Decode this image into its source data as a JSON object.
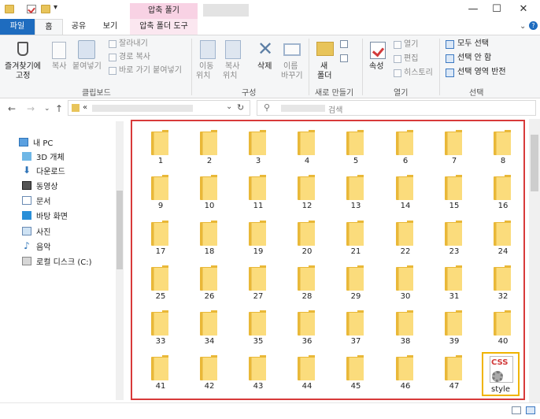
{
  "titlebar": {
    "context_tab_label": "압축 풀기",
    "minimize": "—",
    "maximize": "☐",
    "close": "✕"
  },
  "ribbon_tabs": {
    "file": "파일",
    "home": "홈",
    "share": "공유",
    "view": "보기",
    "context": "압축 폴더 도구"
  },
  "ribbon": {
    "clipboard": {
      "pin_line1": "즐겨찾기에",
      "pin_line2": "고정",
      "copy": "복사",
      "paste": "붙여넣기",
      "cut": "잘라내기",
      "copy_path": "경로 복사",
      "paste_shortcut": "바로 가기 붙여넣기",
      "group": "클립보드"
    },
    "organize": {
      "move_line1": "이동",
      "move_line2": "위치",
      "copyto_line1": "복사",
      "copyto_line2": "위치",
      "delete": "삭제",
      "rename_line1": "이름",
      "rename_line2": "바꾸기",
      "group": "구성"
    },
    "new": {
      "folder_line1": "새",
      "folder_line2": "폴더",
      "group": "새로 만들기"
    },
    "open": {
      "properties": "속성",
      "open": "열기",
      "edit": "편집",
      "history": "히스토리",
      "group": "열기"
    },
    "select": {
      "select_all": "모두 선택",
      "select_none": "선택 안 함",
      "invert": "선택 영역 반전",
      "group": "선택"
    }
  },
  "address": {
    "chevron": "«",
    "search_label": "검색"
  },
  "nav_pane": {
    "items": [
      {
        "label": "내 PC",
        "icon": "computer-icon"
      },
      {
        "label": "3D 개체",
        "icon": "3d-objects-icon"
      },
      {
        "label": "다운로드",
        "icon": "downloads-icon"
      },
      {
        "label": "동영상",
        "icon": "videos-icon"
      },
      {
        "label": "문서",
        "icon": "documents-icon"
      },
      {
        "label": "바탕 화면",
        "icon": "desktop-icon"
      },
      {
        "label": "사진",
        "icon": "pictures-icon"
      },
      {
        "label": "음악",
        "icon": "music-icon"
      },
      {
        "label": "로컬 디스크 (C:)",
        "icon": "drive-icon"
      }
    ]
  },
  "folders": [
    "1",
    "2",
    "3",
    "4",
    "5",
    "6",
    "7",
    "8",
    "9",
    "10",
    "11",
    "12",
    "13",
    "14",
    "15",
    "16",
    "17",
    "18",
    "19",
    "20",
    "21",
    "22",
    "23",
    "24",
    "25",
    "26",
    "27",
    "28",
    "29",
    "30",
    "31",
    "32",
    "33",
    "34",
    "35",
    "36",
    "37",
    "38",
    "39",
    "40",
    "41",
    "42",
    "43",
    "44",
    "45",
    "46",
    "47"
  ],
  "style_file": {
    "badge": "CSS",
    "label": "style"
  },
  "colors": {
    "accent": "#1e6cbf",
    "highlight_box": "#d83a3a",
    "selected_file_box": "#f0b400",
    "context_tab": "#f8d2e4"
  }
}
